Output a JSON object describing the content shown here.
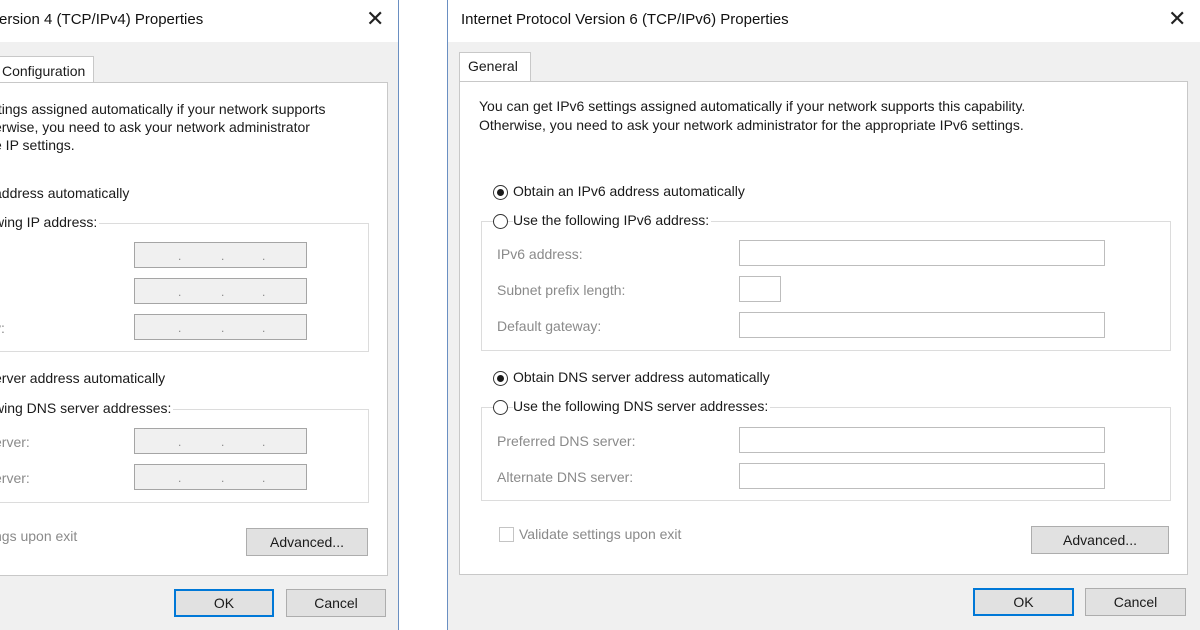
{
  "ipv4_dialog": {
    "title": "ersion 4 (TCP/IPv4) Properties",
    "tab": "Configuration",
    "description_lines": [
      "ttings assigned automatically if your network supports",
      "erwise, you need to ask your network administrator",
      "e IP settings."
    ],
    "radio_obtain_ip": "address automatically",
    "radio_use_ip": "wing IP address:",
    "gateway_label": "y:",
    "radio_obtain_dns": "erver address automatically",
    "radio_use_dns": "wing DNS server addresses:",
    "preferred_dns_label": "erver:",
    "alternate_dns_label": "erver:",
    "validate_label": "ngs upon exit",
    "advanced_label": "Advanced...",
    "ok_label": "OK",
    "cancel_label": "Cancel"
  },
  "ipv6_dialog": {
    "title": "Internet Protocol Version 6 (TCP/IPv6) Properties",
    "tab": "General",
    "description_lines": [
      "You can get IPv6 settings assigned automatically if your network supports this capability.",
      "Otherwise, you need to ask your network administrator for the appropriate IPv6 settings."
    ],
    "radio_obtain_ip": "Obtain an IPv6 address automatically",
    "radio_obtain_ip_checked": true,
    "radio_use_ip": "Use the following IPv6 address:",
    "ipv6_address_label": "IPv6 address:",
    "subnet_label": "Subnet prefix length:",
    "gateway_label": "Default gateway:",
    "radio_obtain_dns": "Obtain DNS server address automatically",
    "radio_obtain_dns_checked": true,
    "radio_use_dns": "Use the following DNS server addresses:",
    "preferred_dns_label": "Preferred DNS server:",
    "alternate_dns_label": "Alternate DNS server:",
    "validate_label": "Validate settings upon exit",
    "validate_checked": false,
    "advanced_label": "Advanced...",
    "ok_label": "OK",
    "cancel_label": "Cancel"
  },
  "icons": {
    "close": "close-icon",
    "dot_separator": "."
  },
  "colors": {
    "focus_border": "#0078d7",
    "dialog_border": "#6a8fc2",
    "disabled_text": "#8a8a8a"
  }
}
